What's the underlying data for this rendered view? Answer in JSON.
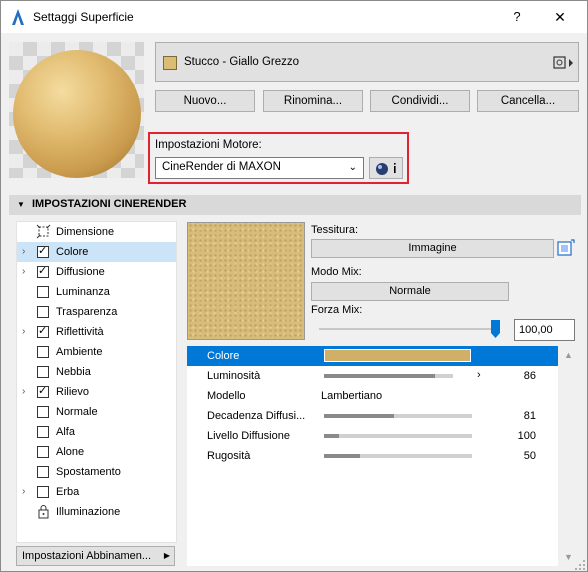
{
  "window": {
    "title": "Settaggi Superficie",
    "help": "?",
    "close": "✕"
  },
  "material": {
    "name": "Stucco - Giallo Grezzo",
    "swatch_color": "#d9bd74",
    "menu_icon": "material-menu-icon"
  },
  "buttons": {
    "new": "Nuovo...",
    "rename": "Rinomina...",
    "share": "Condividi...",
    "delete": "Cancella..."
  },
  "engine": {
    "label": "Impostazioni Motore:",
    "value": "CineRender di MAXON",
    "info_icon": "engine-info-icon"
  },
  "section": {
    "title": "IMPOSTAZIONI CINERENDER"
  },
  "channels": [
    {
      "label": "Dimensione",
      "has_chevron": false,
      "control": "icon",
      "icon": "dimension-icon",
      "checked": null
    },
    {
      "label": "Colore",
      "has_chevron": true,
      "control": "checkbox",
      "checked": true,
      "selected": true
    },
    {
      "label": "Diffusione",
      "has_chevron": true,
      "control": "checkbox",
      "checked": true
    },
    {
      "label": "Luminanza",
      "has_chevron": false,
      "control": "checkbox",
      "checked": false
    },
    {
      "label": "Trasparenza",
      "has_chevron": false,
      "control": "checkbox",
      "checked": false
    },
    {
      "label": "Riflettività",
      "has_chevron": true,
      "control": "checkbox",
      "checked": true
    },
    {
      "label": "Ambiente",
      "has_chevron": false,
      "control": "checkbox",
      "checked": false
    },
    {
      "label": "Nebbia",
      "has_chevron": false,
      "control": "checkbox",
      "checked": false
    },
    {
      "label": "Rilievo",
      "has_chevron": true,
      "control": "checkbox",
      "checked": true
    },
    {
      "label": "Normale",
      "has_chevron": false,
      "control": "checkbox",
      "checked": false
    },
    {
      "label": "Alfa",
      "has_chevron": false,
      "control": "checkbox",
      "checked": false
    },
    {
      "label": "Alone",
      "has_chevron": false,
      "control": "checkbox",
      "checked": false
    },
    {
      "label": "Spostamento",
      "has_chevron": false,
      "control": "checkbox",
      "checked": false
    },
    {
      "label": "Erba",
      "has_chevron": true,
      "control": "checkbox",
      "checked": false
    },
    {
      "label": "Illuminazione",
      "has_chevron": false,
      "control": "icon",
      "icon": "lock-icon",
      "checked": null
    }
  ],
  "assoc_button": {
    "label": "Impostazioni Abbinamen...",
    "arrow": "▶"
  },
  "texture": {
    "label": "Tessitura:",
    "button": "Immagine",
    "icon": "texture-browse-icon"
  },
  "mix": {
    "label": "Modo Mix:",
    "button": "Normale"
  },
  "forza": {
    "label": "Forza Mix:",
    "value": "100,00",
    "level": 1.0
  },
  "properties": [
    {
      "label": "Colore",
      "kind": "swatch",
      "color": "#d0b069",
      "selected": true
    },
    {
      "label": "Luminosità",
      "kind": "slider",
      "level": 0.86,
      "value": "86",
      "marker": "›"
    },
    {
      "label": "Modello",
      "kind": "text",
      "value": "Lambertiano"
    },
    {
      "label": "Decadenza Diffusi...",
      "kind": "slider",
      "level": 0.47,
      "value": "81"
    },
    {
      "label": "Livello Diffusione",
      "kind": "slider",
      "level": 0.1,
      "value": "100"
    },
    {
      "label": "Rugosità",
      "kind": "slider",
      "level": 0.24,
      "value": "50"
    }
  ]
}
